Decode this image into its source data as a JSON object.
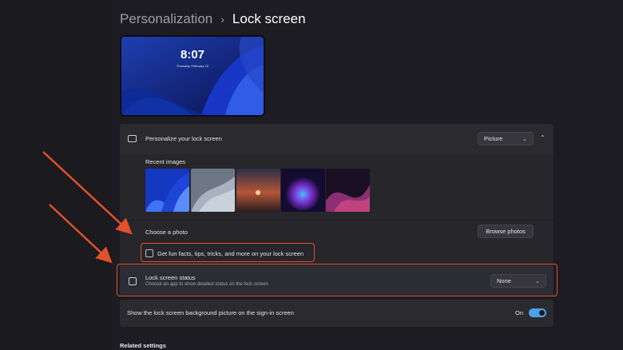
{
  "breadcrumb": {
    "parent": "Personalization",
    "separator": "›",
    "current": "Lock screen"
  },
  "preview": {
    "time": "8:07",
    "date": "Thursday, February 15"
  },
  "personalize": {
    "label": "Personalize your lock screen",
    "value": "Picture",
    "chevron": "⌄",
    "collapse": "⌃"
  },
  "recent_images": {
    "label": "Recent images",
    "items": [
      "blue-bloom",
      "grey-wave",
      "sunset",
      "purple-orb",
      "purple-ribbon"
    ]
  },
  "choose_photo": {
    "label": "Choose a photo",
    "button": "Browse photos"
  },
  "fun_facts": {
    "label": "Get fun facts, tips, tricks, and more on your lock screen",
    "checked": false
  },
  "status": {
    "label": "Lock screen status",
    "description": "Choose an app to show detailed status on the lock screen",
    "value": "None",
    "chevron": "⌄"
  },
  "signin": {
    "label": "Show the lock screen background picture on the sign-in screen",
    "toggle_label": "On",
    "toggle_on": true
  },
  "related": {
    "label": "Related settings"
  },
  "colors": {
    "accent": "#4aa3e8",
    "highlight": "#e2502c"
  }
}
